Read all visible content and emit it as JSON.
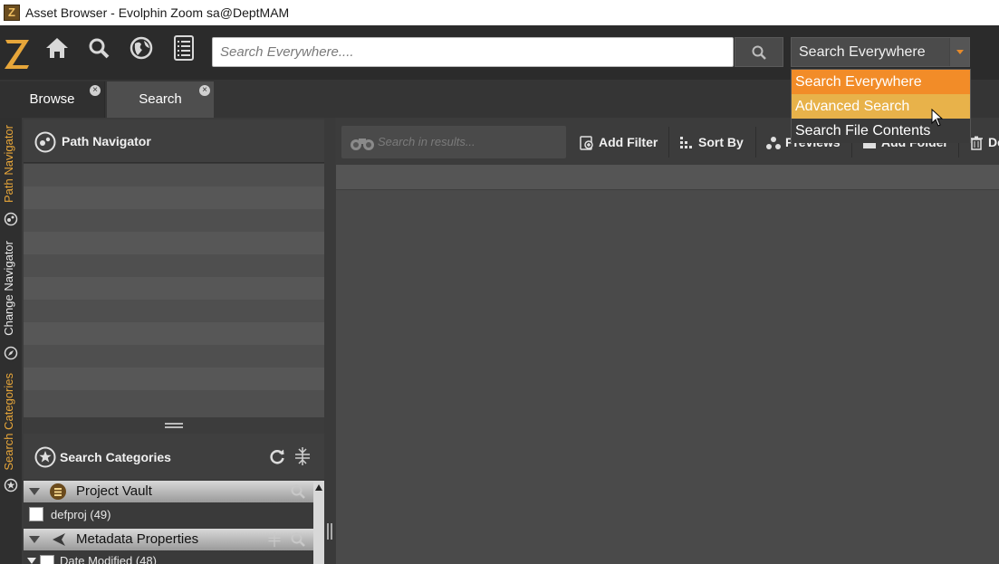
{
  "window": {
    "title": "Asset Browser - Evolphin Zoom sa@DeptMAM",
    "app_icon": "Z"
  },
  "toolbar": {
    "logo": "Z",
    "icons": [
      "home-icon",
      "search-icon",
      "globe-icon",
      "checklist-icon"
    ],
    "search_placeholder": "Search Everywhere....",
    "scope_value": "Search Everywhere"
  },
  "scope_menu": {
    "items": [
      "Search Everywhere",
      "Advanced Search",
      "Search File Contents"
    ],
    "selected_index": 0,
    "hover_index": 1
  },
  "tabs": [
    {
      "label": "Browse",
      "active": false
    },
    {
      "label": "Search",
      "active": true
    }
  ],
  "rail": {
    "labels": [
      "Path Navigator",
      "Change Navigator",
      "Search Categories"
    ]
  },
  "path_navigator": {
    "title": "Path Navigator",
    "rows": 11
  },
  "search_categories": {
    "title": "Search Categories",
    "groups": [
      {
        "label": "Project Vault",
        "items": [
          {
            "label": "defproj (49)"
          }
        ]
      },
      {
        "label": "Metadata Properties",
        "items": [
          {
            "label": "Date Modified (48)"
          }
        ]
      }
    ]
  },
  "results": {
    "search_placeholder": "Search in results...",
    "actions": [
      "Add Filter",
      "Sort By",
      "Previews",
      "Add Folder",
      "Delete"
    ]
  },
  "colors": {
    "accent": "#f28c28",
    "hover": "#e8b24a",
    "rail_text": "#e7a63a",
    "bg": "#3b3b3b"
  }
}
